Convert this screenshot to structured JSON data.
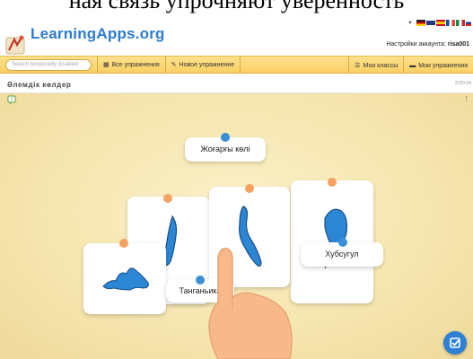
{
  "caption": "ная связь упрочняют уверенность",
  "header": {
    "logo_text": "LearningApps.org",
    "account_label": "Настройки аккаунта:",
    "account_user": "risa001"
  },
  "toolbar": {
    "search_placeholder": "Search temporarily disabled",
    "all_exercises": "Все упражнения",
    "new_exercise": "Новое упражнение",
    "my_classes": "Мои классы",
    "my_exercises": "Мои упражнения"
  },
  "app": {
    "title": "Әлемдік көлдер",
    "date": "2020-04"
  },
  "labels": {
    "upper": "Жоғарғы көлі",
    "khubsugul": "Хубсугул",
    "tanganyika": "Танганьика"
  },
  "colors": {
    "accent": "#2e7bd0",
    "toolbar": "#f9cf63",
    "board": "#f6e6b0",
    "pin_orange": "#f4a25e",
    "pin_blue": "#3b8fd8",
    "lake": "#2b86d4"
  },
  "icons": {
    "logo": "learningapps-logo-icon",
    "grid": "grid-icon",
    "pencil": "pencil-icon",
    "list": "list-icon",
    "folder": "folder-icon",
    "help": "help-icon",
    "check": "check-icon"
  }
}
